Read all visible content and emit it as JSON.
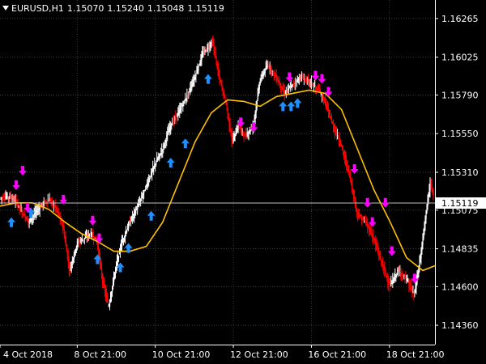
{
  "header": {
    "symbol": "EURUSD,H1",
    "open": "1.15070",
    "high": "1.15240",
    "low": "1.15048",
    "close": "1.15119"
  },
  "colors": {
    "background": "#000000",
    "grid": "#3c3c3c",
    "text": "#ffffff",
    "bull_candle": "#ffffff",
    "bear_candle": "#ff0000",
    "moving_average": "#ffc000",
    "buy_arrow": "#1e90ff",
    "sell_arrow": "#ff00ff",
    "price_line": "#c0c0c0",
    "price_label_bg": "#ffffff",
    "price_label_text": "#000000"
  },
  "chart_data": {
    "type": "candlestick",
    "x_ticks": [
      {
        "label": "4 Oct 2018",
        "t": 0
      },
      {
        "label": "8 Oct 21:00",
        "t": 95
      },
      {
        "label": "10 Oct 21:00",
        "t": 191
      },
      {
        "label": "12 Oct 21:00",
        "t": 287
      },
      {
        "label": "16 Oct 21:00",
        "t": 383
      },
      {
        "label": "18 Oct 21:00",
        "t": 479
      }
    ],
    "y_ticks": [
      "1.16265",
      "1.16025",
      "1.15790",
      "1.15550",
      "1.15310",
      "1.15075",
      "1.14835",
      "1.14600",
      "1.14360"
    ],
    "ylim": [
      1.1424,
      1.1638
    ],
    "xlim": [
      0,
      535
    ],
    "current_price": "1.15119",
    "price_path": [
      [
        0,
        1.1515
      ],
      [
        12,
        1.1516
      ],
      [
        20,
        1.1513
      ],
      [
        28,
        1.1506
      ],
      [
        36,
        1.15
      ],
      [
        44,
        1.1506
      ],
      [
        54,
        1.1512
      ],
      [
        62,
        1.1514
      ],
      [
        70,
        1.1508
      ],
      [
        78,
        1.1497
      ],
      [
        86,
        1.147
      ],
      [
        96,
        1.1488
      ],
      [
        104,
        1.149
      ],
      [
        112,
        1.1493
      ],
      [
        120,
        1.1488
      ],
      [
        126,
        1.1465
      ],
      [
        134,
        1.1447
      ],
      [
        142,
        1.147
      ],
      [
        150,
        1.1487
      ],
      [
        160,
        1.15
      ],
      [
        170,
        1.151
      ],
      [
        180,
        1.1522
      ],
      [
        190,
        1.1535
      ],
      [
        200,
        1.1545
      ],
      [
        210,
        1.156
      ],
      [
        220,
        1.1568
      ],
      [
        230,
        1.1578
      ],
      [
        240,
        1.159
      ],
      [
        250,
        1.1605
      ],
      [
        262,
        1.1612
      ],
      [
        270,
        1.159
      ],
      [
        278,
        1.1575
      ],
      [
        286,
        1.155
      ],
      [
        294,
        1.156
      ],
      [
        302,
        1.1553
      ],
      [
        312,
        1.156
      ],
      [
        320,
        1.1588
      ],
      [
        330,
        1.1598
      ],
      [
        340,
        1.159
      ],
      [
        350,
        1.158
      ],
      [
        360,
        1.1585
      ],
      [
        370,
        1.159
      ],
      [
        380,
        1.1588
      ],
      [
        392,
        1.1582
      ],
      [
        400,
        1.1575
      ],
      [
        410,
        1.156
      ],
      [
        420,
        1.1548
      ],
      [
        430,
        1.153
      ],
      [
        440,
        1.1505
      ],
      [
        450,
        1.15
      ],
      [
        460,
        1.149
      ],
      [
        470,
        1.1475
      ],
      [
        480,
        1.146
      ],
      [
        490,
        1.147
      ],
      [
        500,
        1.1465
      ],
      [
        510,
        1.1455
      ],
      [
        518,
        1.148
      ],
      [
        524,
        1.1505
      ],
      [
        530,
        1.1525
      ],
      [
        535,
        1.151
      ]
    ],
    "series": [
      {
        "values": [
          [
            0,
            1.151
          ],
          [
            20,
            1.1512
          ],
          [
            40,
            1.1512
          ],
          [
            60,
            1.1508
          ],
          [
            80,
            1.15
          ],
          [
            100,
            1.1493
          ],
          [
            120,
            1.1488
          ],
          [
            140,
            1.1482
          ],
          [
            160,
            1.1482
          ],
          [
            180,
            1.1485
          ],
          [
            200,
            1.15
          ],
          [
            220,
            1.1525
          ],
          [
            240,
            1.155
          ],
          [
            260,
            1.1568
          ],
          [
            280,
            1.1576
          ],
          [
            300,
            1.1575
          ],
          [
            320,
            1.1572
          ],
          [
            340,
            1.1578
          ],
          [
            360,
            1.158
          ],
          [
            380,
            1.1582
          ],
          [
            400,
            1.158
          ],
          [
            420,
            1.157
          ],
          [
            440,
            1.1545
          ],
          [
            460,
            1.152
          ],
          [
            480,
            1.15
          ],
          [
            500,
            1.1478
          ],
          [
            520,
            1.147
          ],
          [
            535,
            1.1473
          ]
        ]
      }
    ],
    "buy_signals": [
      [
        14,
        1.1503
      ],
      [
        38,
        1.1509
      ],
      [
        120,
        1.148
      ],
      [
        148,
        1.1475
      ],
      [
        158,
        1.1487
      ],
      [
        186,
        1.1507
      ],
      [
        210,
        1.154
      ],
      [
        228,
        1.1552
      ],
      [
        256,
        1.1592
      ],
      [
        348,
        1.1575
      ],
      [
        358,
        1.1575
      ],
      [
        366,
        1.1577
      ]
    ],
    "sell_signals": [
      [
        20,
        1.152
      ],
      [
        28,
        1.1529
      ],
      [
        34,
        1.1506
      ],
      [
        78,
        1.1511
      ],
      [
        114,
        1.1498
      ],
      [
        122,
        1.1487
      ],
      [
        296,
        1.1559
      ],
      [
        312,
        1.1556
      ],
      [
        356,
        1.1587
      ],
      [
        388,
        1.1588
      ],
      [
        396,
        1.1586
      ],
      [
        404,
        1.1578
      ],
      [
        436,
        1.153
      ],
      [
        452,
        1.1509
      ],
      [
        458,
        1.1497
      ],
      [
        474,
        1.1509
      ],
      [
        482,
        1.1479
      ],
      [
        510,
        1.1462
      ]
    ]
  }
}
